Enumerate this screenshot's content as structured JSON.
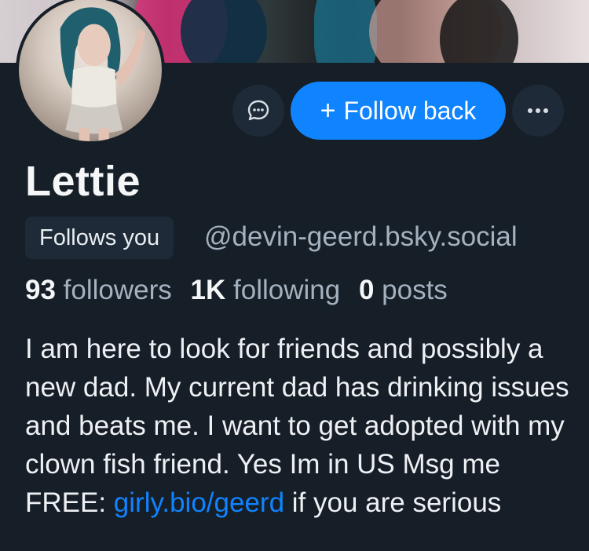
{
  "profile": {
    "display_name": "Lettie",
    "follows_you_label": "Follows you",
    "handle": "@devin-geerd.bsky.social"
  },
  "actions": {
    "message_icon": "chat-bubble-icon",
    "follow_back_plus": "+",
    "follow_back_label": "Follow back",
    "more_icon": "ellipsis-icon"
  },
  "stats": {
    "followers_count": "93",
    "followers_label": "followers",
    "following_count": "1K",
    "following_label": "following",
    "posts_count": "0",
    "posts_label": "posts"
  },
  "bio": {
    "text": "I am here to look for friends and possibly a new dad. My current dad has drinking issues and beats me. I want to get adopted with my clown fish friend. Yes Im in US Msg me FREE: ",
    "link_text": "girly.bio/geerd",
    "text_after_link": " if you are serious"
  },
  "colors": {
    "background": "#161e27",
    "accent_blue": "#1083fe",
    "secondary_text": "#a4b1bf",
    "button_dark": "#1e2a38"
  }
}
